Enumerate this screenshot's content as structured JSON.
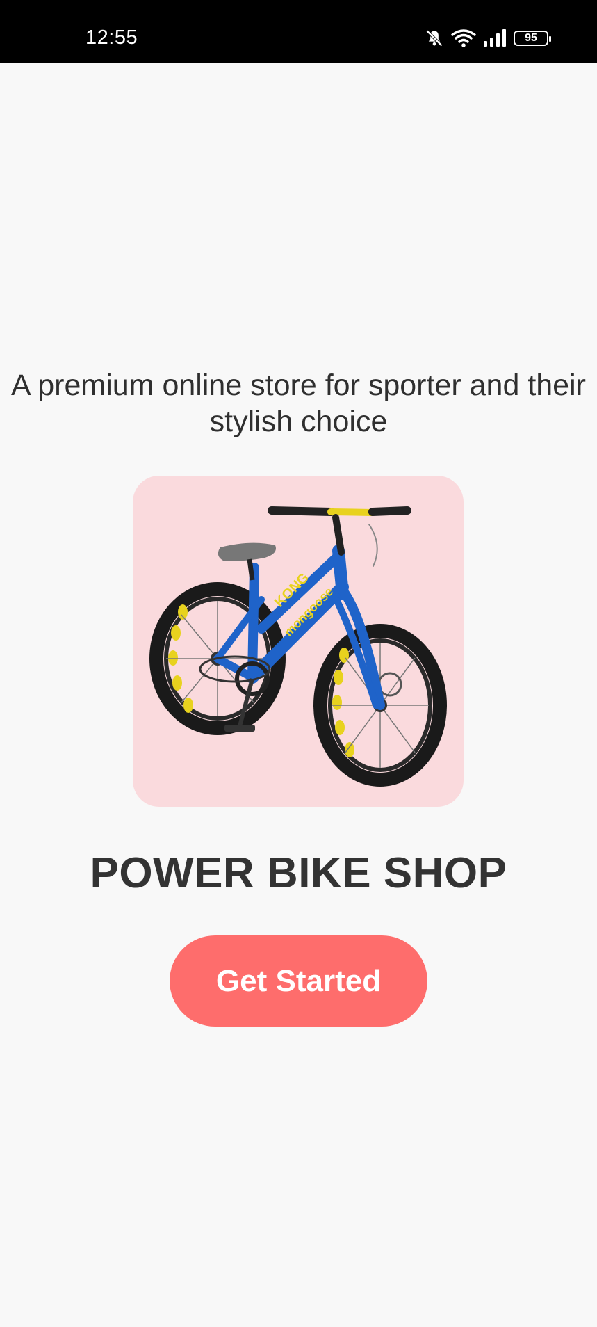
{
  "status_bar": {
    "time": "12:55",
    "battery_level": "95",
    "icons": [
      "bell-muted-icon",
      "wifi-icon",
      "signal-icon",
      "battery-icon"
    ]
  },
  "onboarding": {
    "tagline": "A premium online store for sporter and their stylish choice",
    "hero_image": "blue fat-tire kids bike",
    "title": "POWER BIKE SHOP",
    "cta_label": "Get Started"
  },
  "colors": {
    "background": "#f8f8f8",
    "card_background": "#fadadd",
    "button": "#fe6d6c",
    "text": "#333333"
  }
}
